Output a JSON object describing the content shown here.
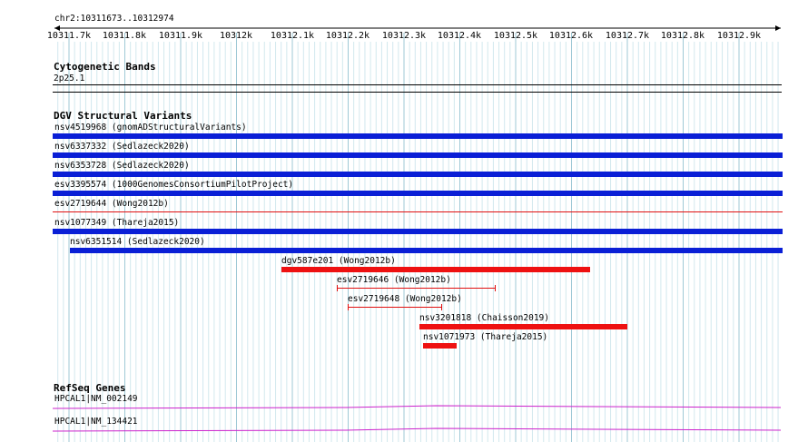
{
  "region": "chr2:10311673..10312974",
  "ruler": {
    "ticks": [
      "10311.7k",
      "10311.8k",
      "10311.9k",
      "10312k",
      "10312.1k",
      "10312.2k",
      "10312.3k",
      "10312.4k",
      "10312.5k",
      "10312.6k",
      "10312.7k",
      "10312.8k",
      "10312.9k"
    ]
  },
  "cytobands": {
    "title": "Cytogenetic Bands",
    "band": "2p25.1"
  },
  "dgv": {
    "title": "DGV Structural Variants",
    "features": [
      {
        "label": "nsv4519968 (gnomADStructuralVariants)",
        "color": "#0a1fd6",
        "style": "thick"
      },
      {
        "label": "nsv6337332 (Sedlazeck2020)",
        "color": "#0a1fd6",
        "style": "thick"
      },
      {
        "label": "nsv6353728 (Sedlazeck2020)",
        "color": "#0a1fd6",
        "style": "thick"
      },
      {
        "label": "esv3395574 (1000GenomesConsortiumPilotProject)",
        "color": "#0a1fd6",
        "style": "thick"
      },
      {
        "label": "esv2719644 (Wong2012b)",
        "color": "#e01010",
        "style": "thin"
      },
      {
        "label": "nsv1077349 (Thareja2015)",
        "color": "#0a1fd6",
        "style": "thick"
      },
      {
        "label": "nsv6351514 (Sedlazeck2020)",
        "color": "#0a1fd6",
        "style": "thick"
      },
      {
        "label": "dgv587e201 (Wong2012b)",
        "color": "#ee1111",
        "style": "thick"
      },
      {
        "label": "esv2719646 (Wong2012b)",
        "color": "#e01010",
        "style": "interval"
      },
      {
        "label": "esv2719648 (Wong2012b)",
        "color": "#e01010",
        "style": "interval"
      },
      {
        "label": "nsv3201818 (Chaisson2019)",
        "color": "#ee1111",
        "style": "thick"
      },
      {
        "label": "nsv1071973 (Thareja2015)",
        "color": "#ee1111",
        "style": "thick"
      }
    ]
  },
  "refseq": {
    "title": "RefSeq Genes",
    "genes": [
      {
        "label": "HPCAL1|NM_002149",
        "color": "#cc22cc"
      },
      {
        "label": "HPCAL1|NM_134421",
        "color": "#cc22cc"
      }
    ]
  }
}
